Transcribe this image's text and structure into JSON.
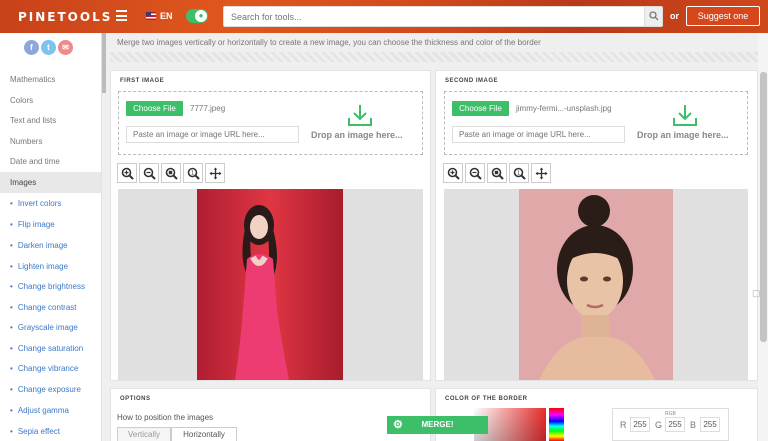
{
  "header": {
    "logo": "PINETOOLS",
    "lang": "EN",
    "search_placeholder": "Search for tools...",
    "or": "or",
    "suggest": "Suggest one"
  },
  "sidebar": {
    "social": [
      "f",
      "t",
      "✉"
    ],
    "categories": [
      "Mathematics",
      "Colors",
      "Text and lists",
      "Numbers",
      "Date and time",
      "Images"
    ],
    "subitems": [
      "Invert colors",
      "Flip image",
      "Darken image",
      "Lighten image",
      "Change brightness",
      "Change contrast",
      "Grayscale image",
      "Change saturation",
      "Change vibrance",
      "Change exposure",
      "Adjust gamma",
      "Sepia effect"
    ]
  },
  "main": {
    "intro": "Merge two images vertically or horizontally to create a new image, you can choose the thickness and color of the border",
    "first": {
      "title": "FIRST IMAGE",
      "choose": "Choose File",
      "filename": "7777.jpeg",
      "url_placeholder": "Paste an image or image URL here...",
      "drop": "Drop an image here..."
    },
    "second": {
      "title": "SECOND IMAGE",
      "choose": "Choose File",
      "filename": "jimmy-fermi...-unsplash.jpg",
      "url_placeholder": "Paste an image or image URL here...",
      "drop": "Drop an image here..."
    },
    "options": {
      "title": "OPTIONS",
      "label": "How to position the images",
      "vertical": "Vertically",
      "horizontal": "Horizontally"
    },
    "border": {
      "title": "COLOR OF THE BORDER",
      "rgb_title": "RGB",
      "r": "255",
      "g": "255",
      "b": "255",
      "r_label": "R",
      "g_label": "G",
      "b_label": "B"
    },
    "merge": "MERGE!"
  },
  "colors": {
    "accent": "#3dbf6a",
    "brand": "#d6481c",
    "link": "#3b79c8"
  }
}
